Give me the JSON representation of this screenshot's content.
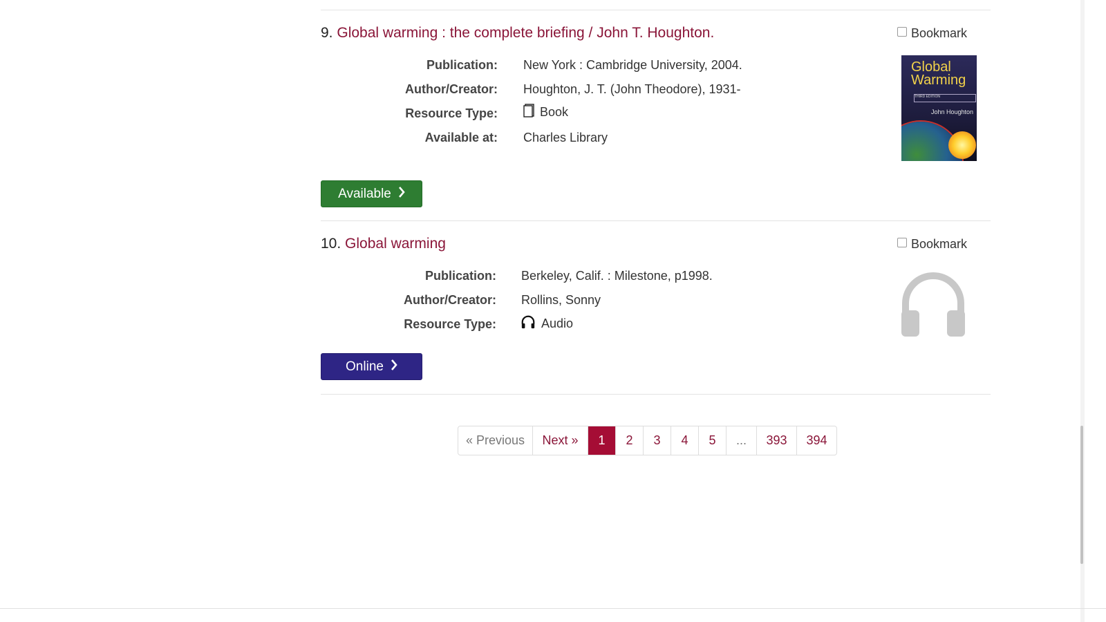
{
  "results": [
    {
      "number": "9.",
      "title": "Global warming : the complete briefing / John T. Houghton.",
      "bookmark_label": "Bookmark",
      "fields": {
        "publication_label": "Publication:",
        "publication": "New York : Cambridge University, 2004.",
        "author_label": "Author/Creator:",
        "author": "Houghton, J. T. (John Theodore), 1931-",
        "type_label": "Resource Type:",
        "type": "Book",
        "available_label": "Available at:",
        "available": "Charles Library"
      },
      "button_label": "Available",
      "button_color": "#2e7d32",
      "cover": {
        "title": "Global Warming",
        "edition": "THIRD EDITION",
        "author": "John Houghton"
      }
    },
    {
      "number": "10.",
      "title": "Global warming",
      "bookmark_label": "Bookmark",
      "fields": {
        "publication_label": "Publication:",
        "publication": "Berkeley, Calif. : Milestone, p1998.",
        "author_label": "Author/Creator:",
        "author": "Rollins, Sonny",
        "type_label": "Resource Type:",
        "type": "Audio"
      },
      "button_label": "Online",
      "button_color": "#2e2585"
    }
  ],
  "pagination": {
    "previous": "« Previous",
    "next": "Next »",
    "pages": [
      "1",
      "2",
      "3",
      "4",
      "5",
      "...",
      "393",
      "394"
    ],
    "current": "1"
  },
  "colors": {
    "link": "#8a1538",
    "active_page": "#a50d35"
  },
  "icons": {
    "book": "book-icon",
    "audio": "headphones-icon",
    "chevron": "chevron-right-icon"
  }
}
